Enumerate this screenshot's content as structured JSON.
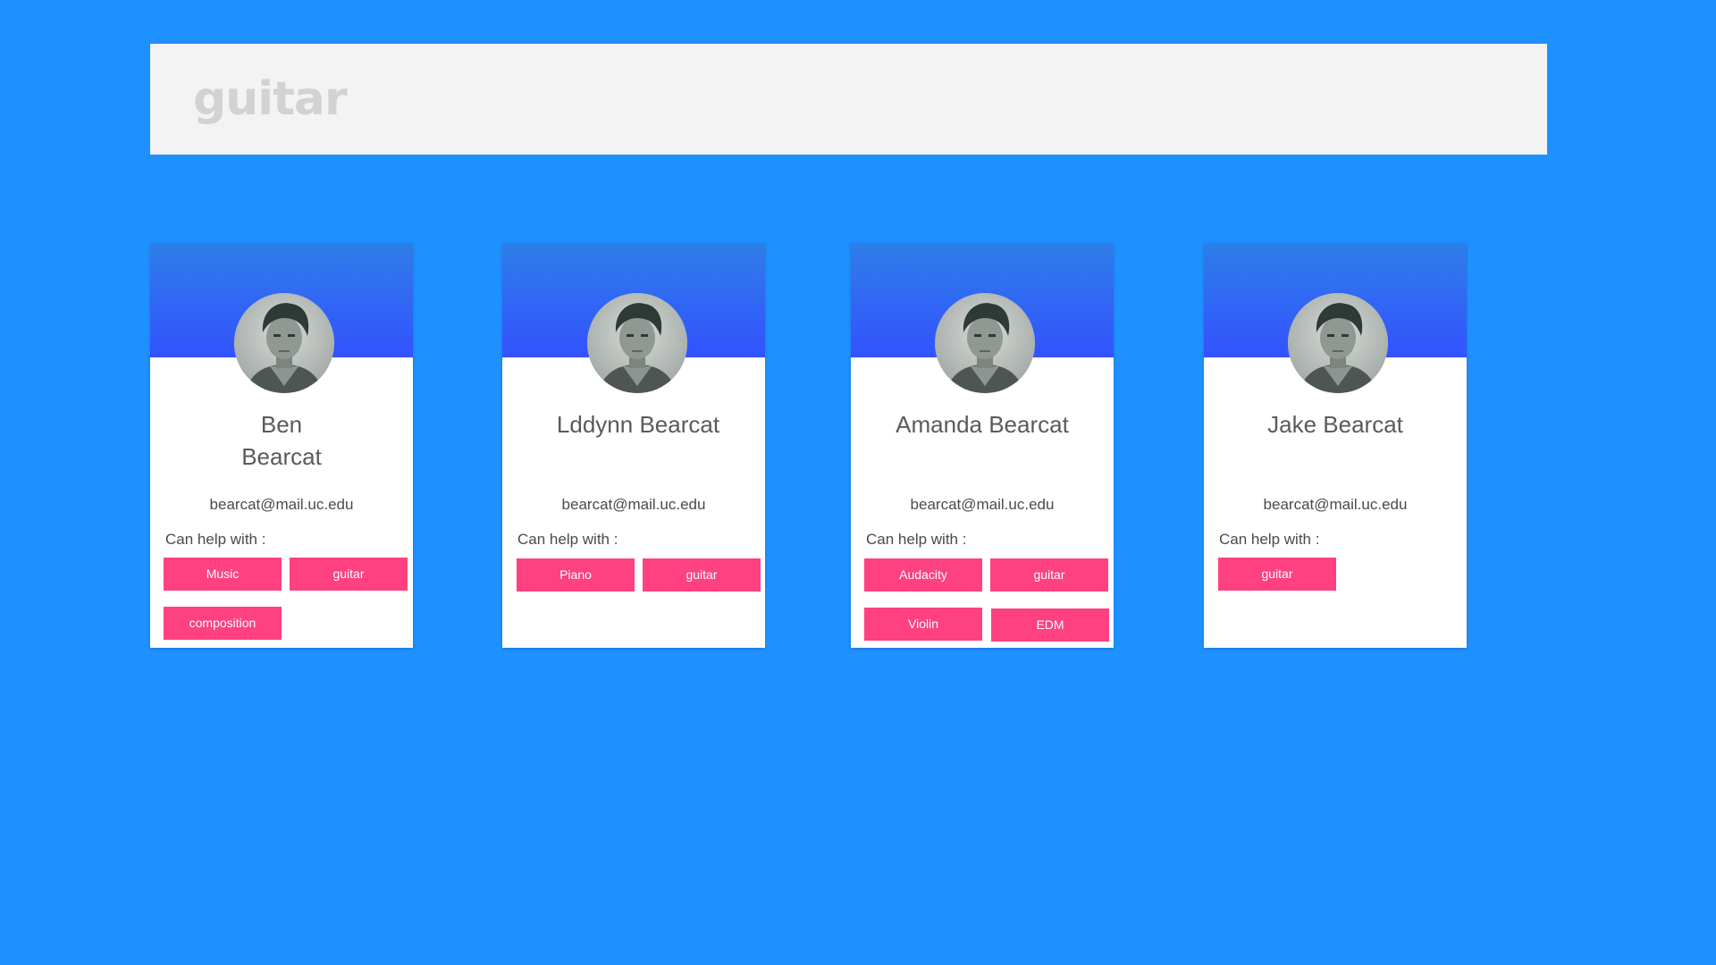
{
  "search": {
    "value": "guitar"
  },
  "colors": {
    "background": "#1e90ff",
    "header_gradient_top": "#2e7ee8",
    "header_gradient_bottom": "#3352ff",
    "tag": "#ff4081"
  },
  "help_label": "Can help with :",
  "cards": [
    {
      "first": "Ben",
      "last": "Bearcat",
      "name": "Ben Bearcat",
      "email": "bearcat@mail.uc.edu",
      "tags": [
        "Music",
        "guitar",
        "composition"
      ]
    },
    {
      "name": "Lddynn Bearcat",
      "email": "bearcat@mail.uc.edu",
      "tags": [
        "Piano",
        "guitar"
      ]
    },
    {
      "name": "Amanda Bearcat",
      "email": "bearcat@mail.uc.edu",
      "tags": [
        "Audacity",
        "guitar",
        "Violin",
        "EDM"
      ]
    },
    {
      "name": "Jake Bearcat",
      "email": "bearcat@mail.uc.edu",
      "tags": [
        "guitar"
      ]
    }
  ]
}
